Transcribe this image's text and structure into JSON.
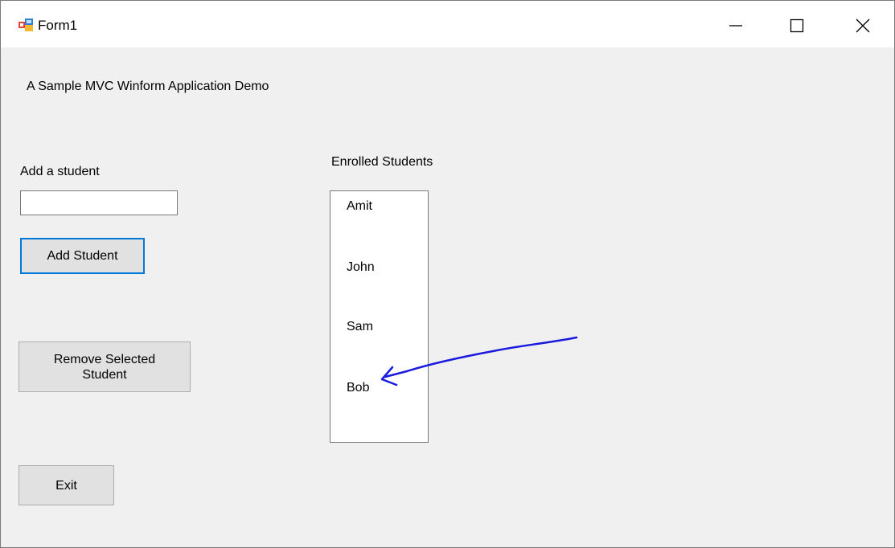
{
  "window": {
    "title": "Form1",
    "icon": "winform-app-icon",
    "controls": {
      "minimize_icon": "minimize-icon",
      "maximize_icon": "maximize-icon",
      "close_icon": "close-icon"
    }
  },
  "form": {
    "heading": "A Sample MVC Winform Application Demo",
    "add_label": "Add a student",
    "student_input": {
      "value": "",
      "placeholder": ""
    },
    "add_button": "Add Student",
    "remove_button": "Remove Selected\nStudent",
    "exit_button": "Exit",
    "enrolled_label": "Enrolled Students",
    "students": [
      "Amit",
      "John",
      "Sam",
      "Bob"
    ]
  },
  "annotation": {
    "type": "hand-drawn-arrow",
    "color": "#1a1adf",
    "points_to": "Bob"
  }
}
